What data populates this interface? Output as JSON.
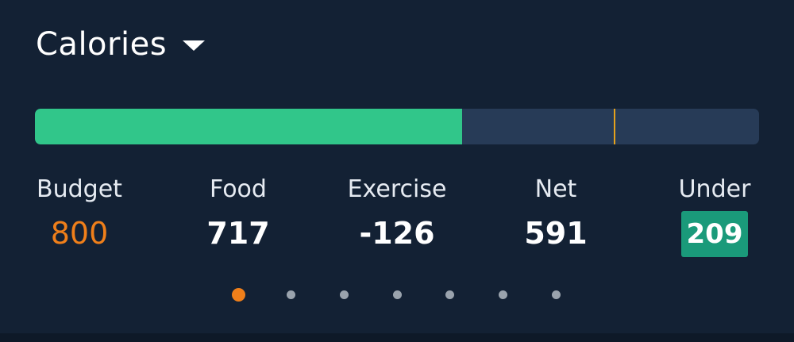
{
  "header": {
    "title": "Calories",
    "dropdown_icon": "caret-down-icon"
  },
  "progress": {
    "fraction_consumed": 0.59,
    "target_marker_fraction": 0.8,
    "fill_color": "#31c68a",
    "track_color": "#273b57",
    "marker_color": "#e6a21c"
  },
  "stats": [
    {
      "label": "Budget",
      "value": "800",
      "style": "orange"
    },
    {
      "label": "Food",
      "value": "717",
      "style": "plain"
    },
    {
      "label": "Exercise",
      "value": "-126",
      "style": "plain"
    },
    {
      "label": "Net",
      "value": "591",
      "style": "plain"
    },
    {
      "label": "Under",
      "value": "209",
      "style": "badge"
    }
  ],
  "colors": {
    "background": "#132134",
    "accent_orange": "#ef7f1a",
    "under_badge": "#1a9a7a"
  },
  "pager": {
    "page_count": 7,
    "active_page": 1
  }
}
